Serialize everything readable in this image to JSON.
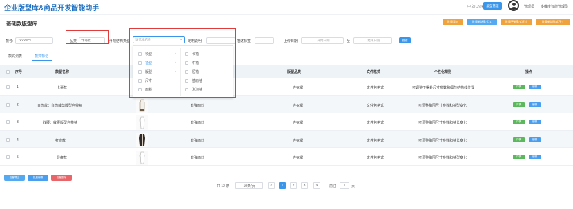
{
  "app": {
    "title": "企业版型库&商品开发智能助手",
    "language": "中文(CN)▾",
    "top_buttons": [
      "版型管理",
      "智能选款"
    ],
    "user_short": "管理员",
    "user_name": "多维度智能管理员"
  },
  "page": {
    "title": "基础款版型库",
    "action_buttons_orange": [
      "批量导入",
      "批量新增款式(1)",
      "批量更新款式尺寸"
    ],
    "action_buttons_blue": [
      "批量新增款式尺寸"
    ]
  },
  "filters": {
    "code_label": "款号:",
    "code_value": "JXYYSCL",
    "category_label": "品类:",
    "category_value": "卡哥款",
    "attr_label": "外观结构类型:",
    "attr_placeholder": "请选择结构",
    "custom_label": "定制说明:",
    "tag_label": "描述标签:",
    "date_label": "上传日期:",
    "date_start": "开始日期",
    "date_sep": "至",
    "date_end": "结束日期",
    "search_button": "搜索"
  },
  "dropdown": {
    "left_items": [
      {
        "label": "领型",
        "highlight": false
      },
      {
        "label": "袖型",
        "highlight": true
      },
      {
        "label": "版型",
        "highlight": false
      },
      {
        "label": "尺寸",
        "highlight": false
      },
      {
        "label": "面料",
        "highlight": false
      }
    ],
    "right_items": [
      "长袖",
      "中袖",
      "短袖",
      "插肩袖",
      "泡泡袖"
    ]
  },
  "tabs": [
    "款式列表",
    "款式标记"
  ],
  "table": {
    "headers": [
      "序号",
      "款型名称",
      "款式图片",
      "面料类型",
      "版型品类",
      "文件格式",
      "个性化规则",
      "操作"
    ],
    "rows": [
      {
        "index": "1",
        "name": "卡哥款",
        "fabric": "",
        "category": "连衣裙",
        "format": "文件包格式",
        "rule": "可调整下摆处尺寸参数和细节结构线位置",
        "has_image": false
      },
      {
        "index": "2",
        "name": "直筒款：直筒裁剪版型自带袖",
        "fabric": "有弹面料",
        "category": "连衣裙",
        "format": "文件包格式",
        "rule": "可调整胸围尺寸参数和袖型变化",
        "has_image": true
      },
      {
        "index": "3",
        "name": "收腰：收腰版型自带袖",
        "fabric": "有弹面料",
        "category": "连衣裙",
        "format": "文件包格式",
        "rule": "可调整胸围尺寸参数和袖长变化",
        "has_image": true
      },
      {
        "index": "4",
        "name": "打底款",
        "fabric": "有弹面料",
        "category": "连衣裙",
        "format": "文件包格式",
        "rule": "可调整胸围尺寸参数和袖长变化",
        "has_image": true
      },
      {
        "index": "5",
        "name": "显瘦款",
        "fabric": "有弹面料",
        "category": "连衣裙",
        "format": "文件包格式",
        "rule": "可调整胸围尺寸参数和袖型变化",
        "has_image": true
      }
    ],
    "row_action_green": "详情",
    "row_action_blue": "编辑"
  },
  "footer_buttons": [
    "批量导出",
    "批量编辑",
    "批量删除"
  ],
  "pagination": {
    "total": "共 12 条",
    "page_size": "10条/页",
    "prev": "<",
    "pages": [
      "1",
      "2",
      "3"
    ],
    "next": ">",
    "goto_label": "前往",
    "goto_value": "1",
    "page_suffix": "页"
  },
  "colors": {
    "primary": "#3a96ea",
    "orange": "#f0a33c",
    "green": "#5cb85c",
    "danger": "#e8666a",
    "annotation_red": "#e23b3b"
  }
}
